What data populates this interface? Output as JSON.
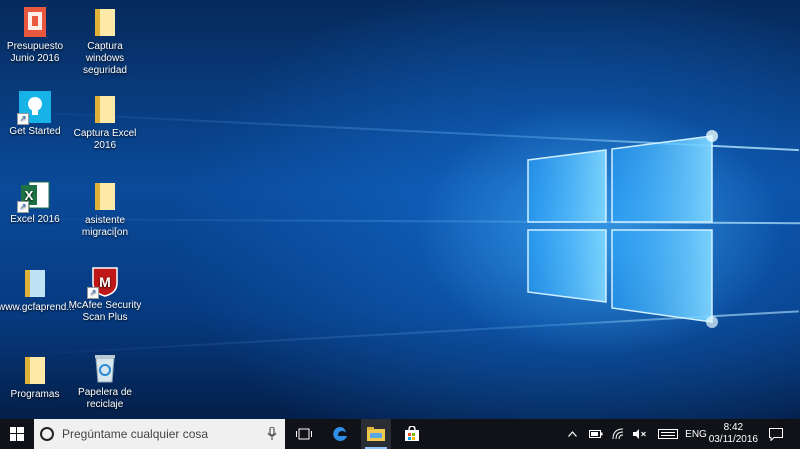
{
  "desktop": {
    "icons": [
      {
        "label": "Presupuesto Junio 2016",
        "icon": "pdf-document-icon"
      },
      {
        "label": "Captura windows seguridad",
        "icon": "folder-icon"
      },
      {
        "label": "Get Started",
        "icon": "lightbulb-icon"
      },
      {
        "label": "Captura Excel 2016",
        "icon": "folder-icon"
      },
      {
        "label": "Excel 2016",
        "icon": "excel-icon"
      },
      {
        "label": "asistente migraci[on",
        "icon": "folder-icon"
      },
      {
        "label": "www.gcfaprend...",
        "icon": "folder-icon"
      },
      {
        "label": "McAfee Security Scan Plus",
        "icon": "mcafee-icon"
      },
      {
        "label": "Programas",
        "icon": "folder-icon"
      },
      {
        "label": "Papelera de reciclaje",
        "icon": "recycle-bin-icon"
      }
    ]
  },
  "taskbar": {
    "search_placeholder": "Pregúntame cualquier cosa",
    "language": "ENG",
    "time": "8:42",
    "date": "03/11/2016"
  },
  "colors": {
    "taskbar": "#101218",
    "wallpaper": "#0a4a9a",
    "folder": "#f2c94c",
    "excel": "#1e7145",
    "accent": "#8fc3ff"
  }
}
